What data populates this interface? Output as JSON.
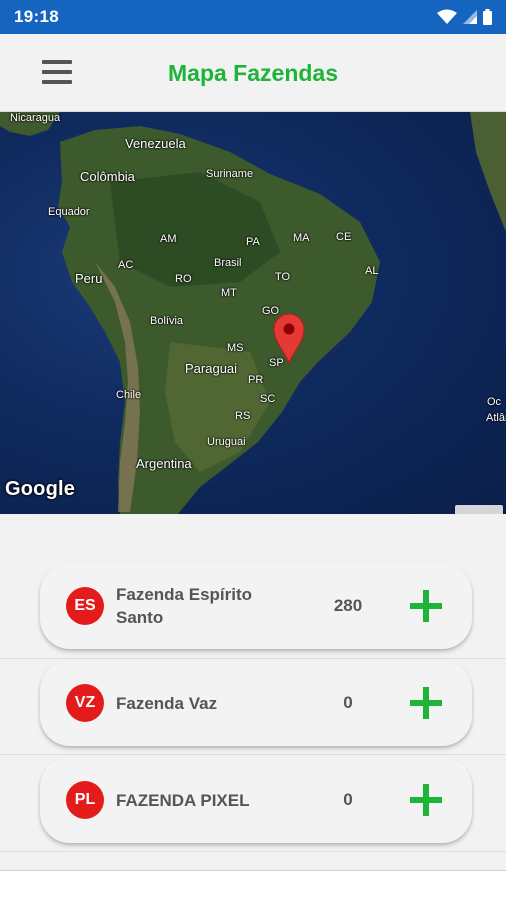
{
  "status_bar": {
    "time": "19:18",
    "icons": [
      "wifi-icon",
      "signal-icon",
      "battery-icon"
    ],
    "background": "#1565c0"
  },
  "app_bar": {
    "title": "Mapa Fazendas",
    "menu_icon": "menu-icon",
    "title_color": "#1fb33a"
  },
  "map": {
    "labels": [
      "Nicaragua",
      "Venezuela",
      "Colômbia",
      "Suriname",
      "Equador",
      "AM",
      "PA",
      "MA",
      "CE",
      "AC",
      "RO",
      "Brasil",
      "TO",
      "AL",
      "Peru",
      "MT",
      "Bolívia",
      "GO",
      "MS",
      "Paraguai",
      "SP",
      "PR",
      "Chile",
      "SC",
      "RS",
      "Uruguai",
      "Argentina",
      "Oc",
      "Atlân"
    ],
    "attribution": "Google",
    "zoom_in_label": "+",
    "zoom_out_label": "−",
    "marker_icon": "map-pin-icon",
    "marker_color": "#e53935"
  },
  "farms": [
    {
      "code": "ES",
      "name": "Fazenda Espírito Santo",
      "count": "280",
      "add_icon": "plus-icon"
    },
    {
      "code": "VZ",
      "name": "Fazenda Vaz",
      "count": "0",
      "add_icon": "plus-icon"
    },
    {
      "code": "PL",
      "name": "FAZENDA PIXEL",
      "count": "0",
      "add_icon": "plus-icon"
    }
  ],
  "colors": {
    "badge": "#e31b1b",
    "add_button": "#1fb33a"
  }
}
